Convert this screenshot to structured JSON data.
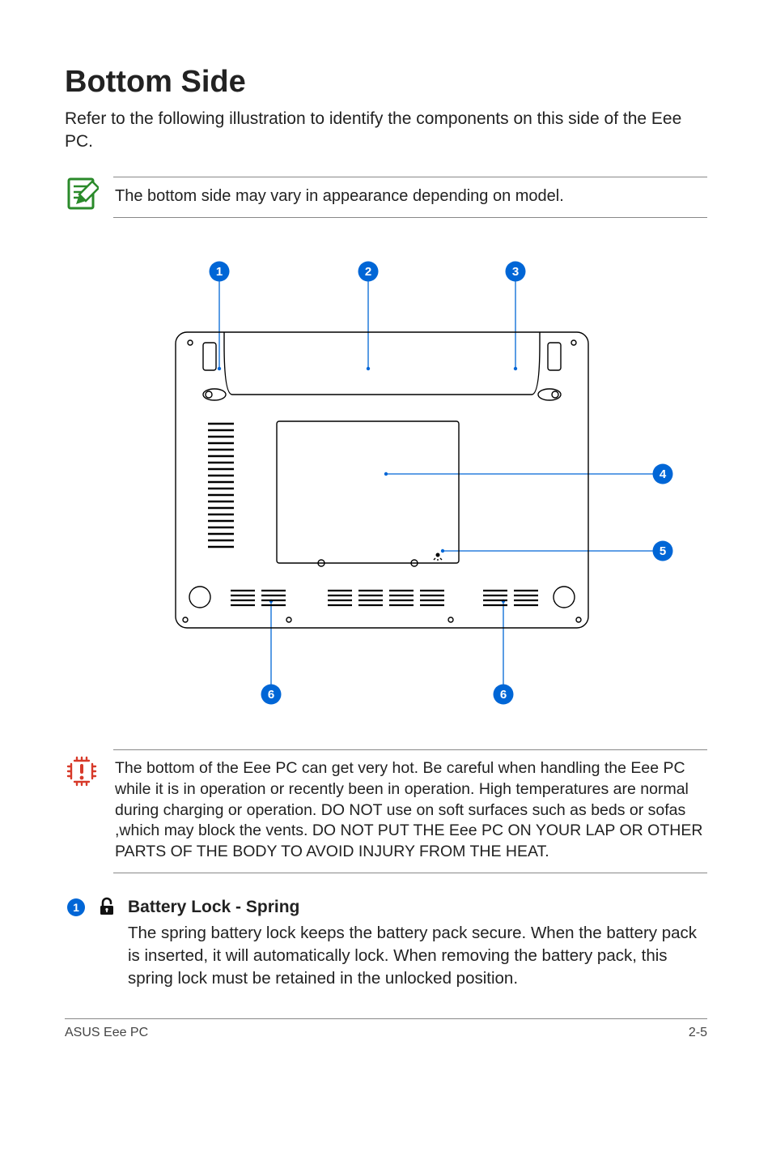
{
  "heading": "Bottom Side",
  "intro": "Refer to the following illustration to identify the components on this side of the Eee PC.",
  "note": "The bottom side may vary in appearance depending on model.",
  "callouts": {
    "c1": "1",
    "c2": "2",
    "c3": "3",
    "c4": "4",
    "c5": "5",
    "c6a": "6",
    "c6b": "6"
  },
  "warning": "The bottom of the Eee PC can get very hot. Be careful when handling the Eee PC while it is in operation or recently been in operation. High temperatures are normal during charging or operation. DO NOT use on soft surfaces such as beds or sofas ,which may block the vents. DO NOT PUT THE Eee PC ON YOUR LAP OR OTHER PARTS OF THE BODY TO AVOID INJURY FROM THE HEAT.",
  "item1": {
    "number": "1",
    "title": "Battery Lock - Spring",
    "text": "The spring battery lock keeps the battery pack secure. When the battery pack is inserted, it will automatically lock. When removing the battery pack, this spring lock must be retained in the unlocked position."
  },
  "footer_left": "ASUS Eee PC",
  "footer_right": "2-5"
}
